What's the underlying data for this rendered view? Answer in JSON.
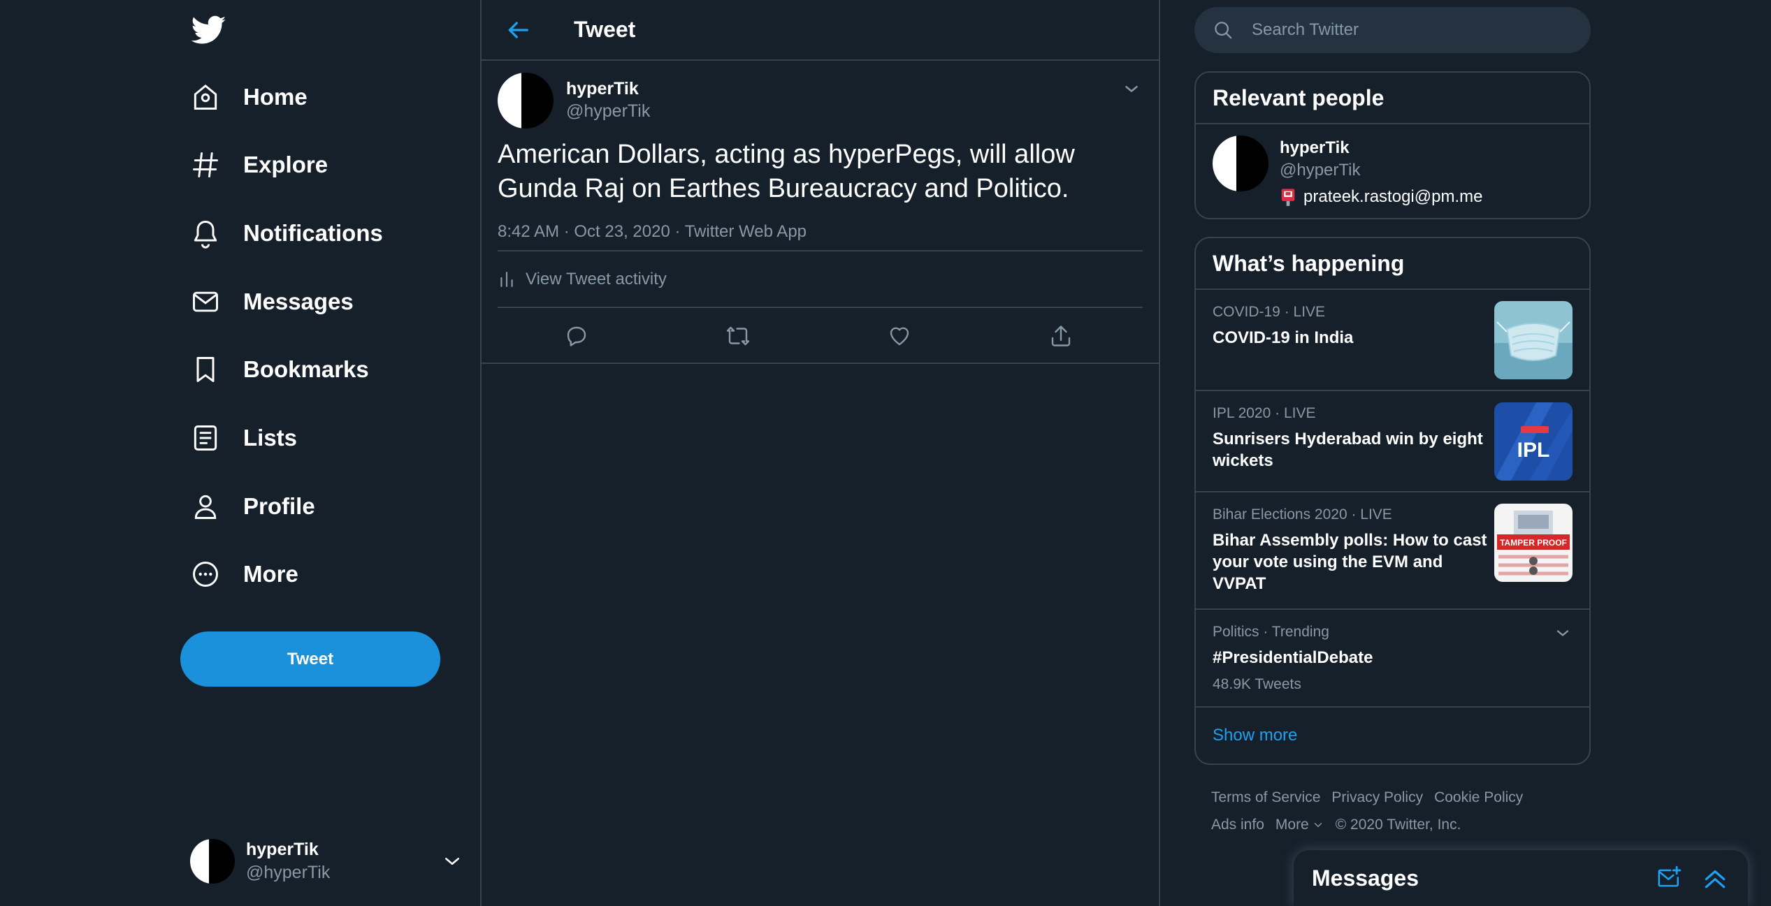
{
  "theme": {
    "accent": "#1da1f2",
    "tweet_button": "#1a91da",
    "background": "#15202b",
    "border": "#38444d",
    "muted": "#8899a6"
  },
  "sidebar": {
    "logo_icon": "twitter-bird-icon",
    "nav": [
      {
        "label": "Home",
        "icon": "home-icon"
      },
      {
        "label": "Explore",
        "icon": "hashtag-icon"
      },
      {
        "label": "Notifications",
        "icon": "bell-icon"
      },
      {
        "label": "Messages",
        "icon": "envelope-icon"
      },
      {
        "label": "Bookmarks",
        "icon": "bookmark-icon"
      },
      {
        "label": "Lists",
        "icon": "list-icon"
      },
      {
        "label": "Profile",
        "icon": "person-icon"
      },
      {
        "label": "More",
        "icon": "more-circle-icon"
      }
    ],
    "tweet_button": "Tweet",
    "account": {
      "name": "hyperTik",
      "handle": "@hyperTik"
    }
  },
  "main": {
    "header_title": "Tweet",
    "tweet": {
      "author_name": "hyperTik",
      "author_handle": "@hyperTik",
      "text": "American Dollars, acting as hyperPegs, will allow Gunda Raj on Earthes Bureaucracy and Politico.",
      "time": "8:42 AM · Oct 23, 2020 · ",
      "source": "Twitter Web App",
      "activity_label": "View Tweet activity",
      "actions": [
        "reply-icon",
        "retweet-icon",
        "like-icon",
        "share-icon"
      ]
    }
  },
  "right": {
    "search_placeholder": "Search Twitter",
    "relevant": {
      "title": "Relevant people",
      "person": {
        "name": "hyperTik",
        "handle": "@hyperTik",
        "email": "prateek.rastogi@pm.me"
      }
    },
    "happening": {
      "title": "What’s happening",
      "trends": [
        {
          "meta": "COVID-19 · LIVE",
          "title": "COVID-19 in India",
          "thumb": "mask"
        },
        {
          "meta": "IPL 2020 · LIVE",
          "title": "Sunrisers Hyderabad win by eight wickets",
          "thumb": "ipl"
        },
        {
          "meta": "Bihar Elections 2020 · LIVE",
          "title": "Bihar Assembly polls: How to cast your vote using the EVM and VVPAT",
          "thumb": "evm"
        },
        {
          "meta": "Politics · Trending",
          "title": "#PresidentialDebate",
          "count": "48.9K Tweets"
        }
      ],
      "show_more": "Show more",
      "ipl_logo_text": "IPL",
      "tamper_text": "TAMPER PROOF"
    },
    "footer": {
      "links": [
        "Terms of Service",
        "Privacy Policy",
        "Cookie Policy",
        "Ads info",
        "More"
      ],
      "copyright": "© 2020 Twitter, Inc."
    }
  },
  "drawer": {
    "title": "Messages"
  }
}
